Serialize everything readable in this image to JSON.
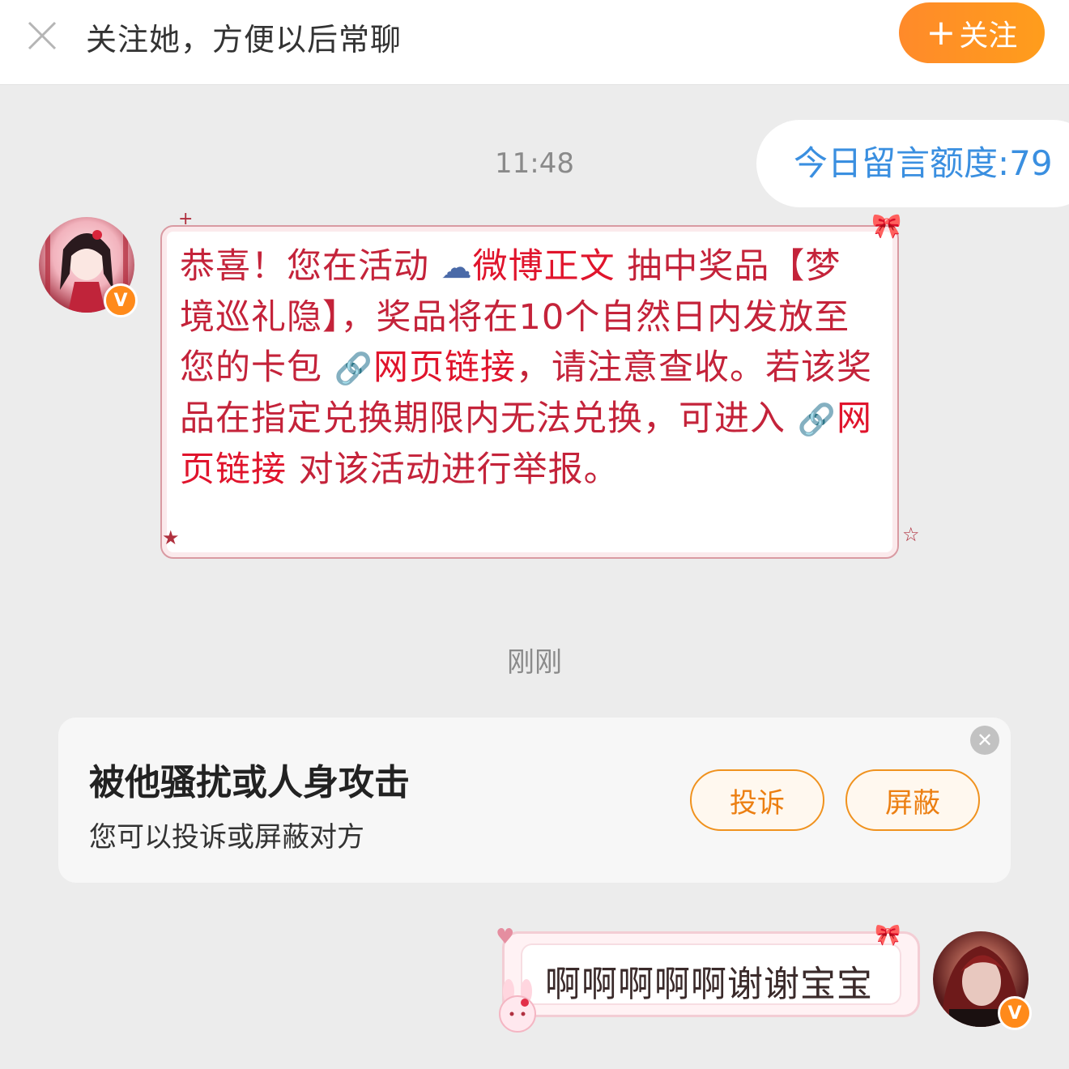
{
  "header": {
    "close_icon": "close-icon",
    "title": "关注她，方便以后常聊",
    "follow_plus": "+",
    "follow_label": "关注"
  },
  "quota": {
    "text": "今日留言额度:79"
  },
  "timestamps": {
    "first": "11:48",
    "second": "刚刚"
  },
  "incoming_message": {
    "part1": "恭喜！您在活动 ",
    "link1_icon": "weibo-icon",
    "link1": "微博正文",
    "part2": " 抽中奖品【梦境巡礼隐】，奖品将在10个自然日内发放至您的卡包 ",
    "link2_icon": "link-icon",
    "link2": "网页链接",
    "part3": "，请注意查收。若该奖品在指定兑换期限内无法兑换，可进入 ",
    "link3_icon": "link-icon",
    "link3": "网页链接",
    "part4": " 对该活动进行举报。"
  },
  "report_card": {
    "title": "被他骚扰或人身攻击",
    "subtitle": "您可以投诉或屏蔽对方",
    "complain_label": "投诉",
    "block_label": "屏蔽",
    "close_icon": "close-icon"
  },
  "outgoing_message": {
    "text": "啊啊啊啊啊谢谢宝宝"
  },
  "badges": {
    "verified": "V"
  },
  "colors": {
    "accent_orange": "#ff8a1a",
    "quota_blue": "#3a8fe0",
    "message_red": "#c4233a",
    "link_red": "#e0142c"
  }
}
